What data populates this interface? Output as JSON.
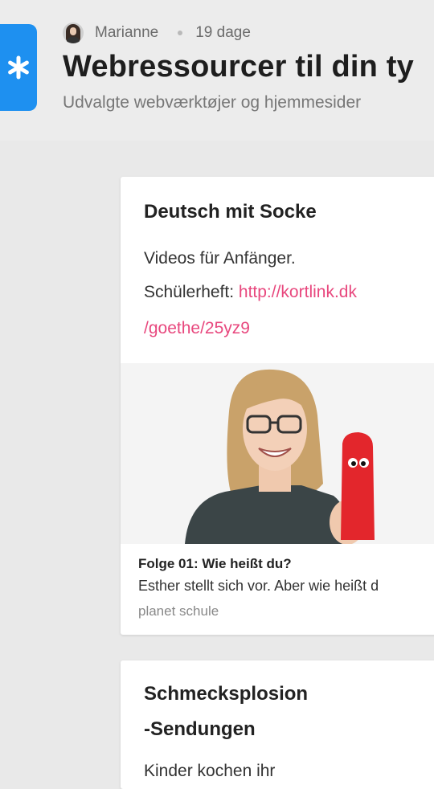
{
  "header": {
    "author": "Marianne",
    "age": "19 dage",
    "title": "Webressourcer til din ty",
    "subtitle": "Udvalgte webværktøjer og hjemmesider",
    "app_icon": "asterisk-icon",
    "accent": "#1e90f0"
  },
  "cards": [
    {
      "title": "Deutsch mit Socke",
      "line1": "Videos für Anfänger.",
      "line2_label": "Schülerheft: ",
      "line2_link_a": "http://kortlink.dk",
      "line2_link_b": "/goethe/25yz9",
      "link_color": "#e8487e",
      "preview": {
        "title": "Folge 01: Wie heißt du?",
        "description": "Esther stellt sich vor. Aber wie heißt d",
        "source": "planet schule"
      }
    },
    {
      "title_line1": "Schmecksplosion",
      "title_line2": "-Sendungen",
      "text_partial": "Kinder kochen ihr"
    }
  ]
}
